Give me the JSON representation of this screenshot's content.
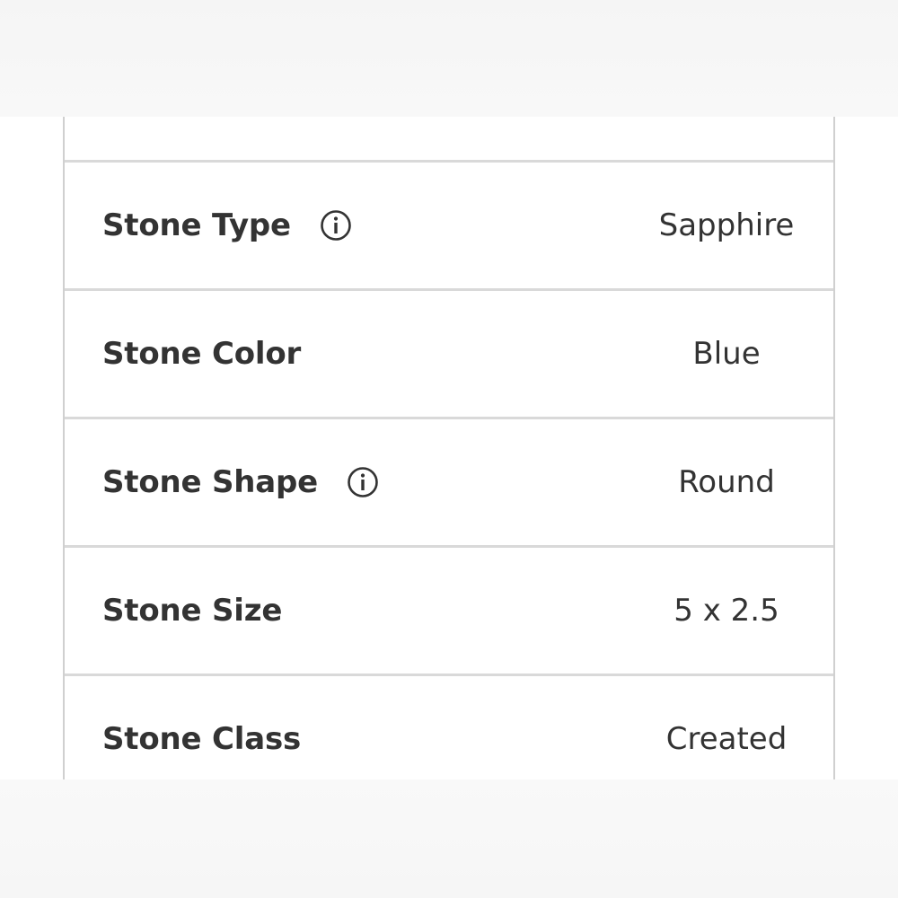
{
  "specs": {
    "rows": [
      {
        "label": "Stone Type",
        "value": "Sapphire",
        "info_icon": "info-circle-icon"
      },
      {
        "label": "Stone Color",
        "value": "Blue"
      },
      {
        "label": "Stone Shape",
        "value": "Round",
        "info_icon": "info-circle-icon"
      },
      {
        "label": "Stone Size",
        "value": "5 x 2.5"
      },
      {
        "label": "Stone Class",
        "value": "Created"
      }
    ]
  },
  "colors": {
    "text": "#333333",
    "border": "#d9d9d9",
    "background": "#ffffff"
  }
}
